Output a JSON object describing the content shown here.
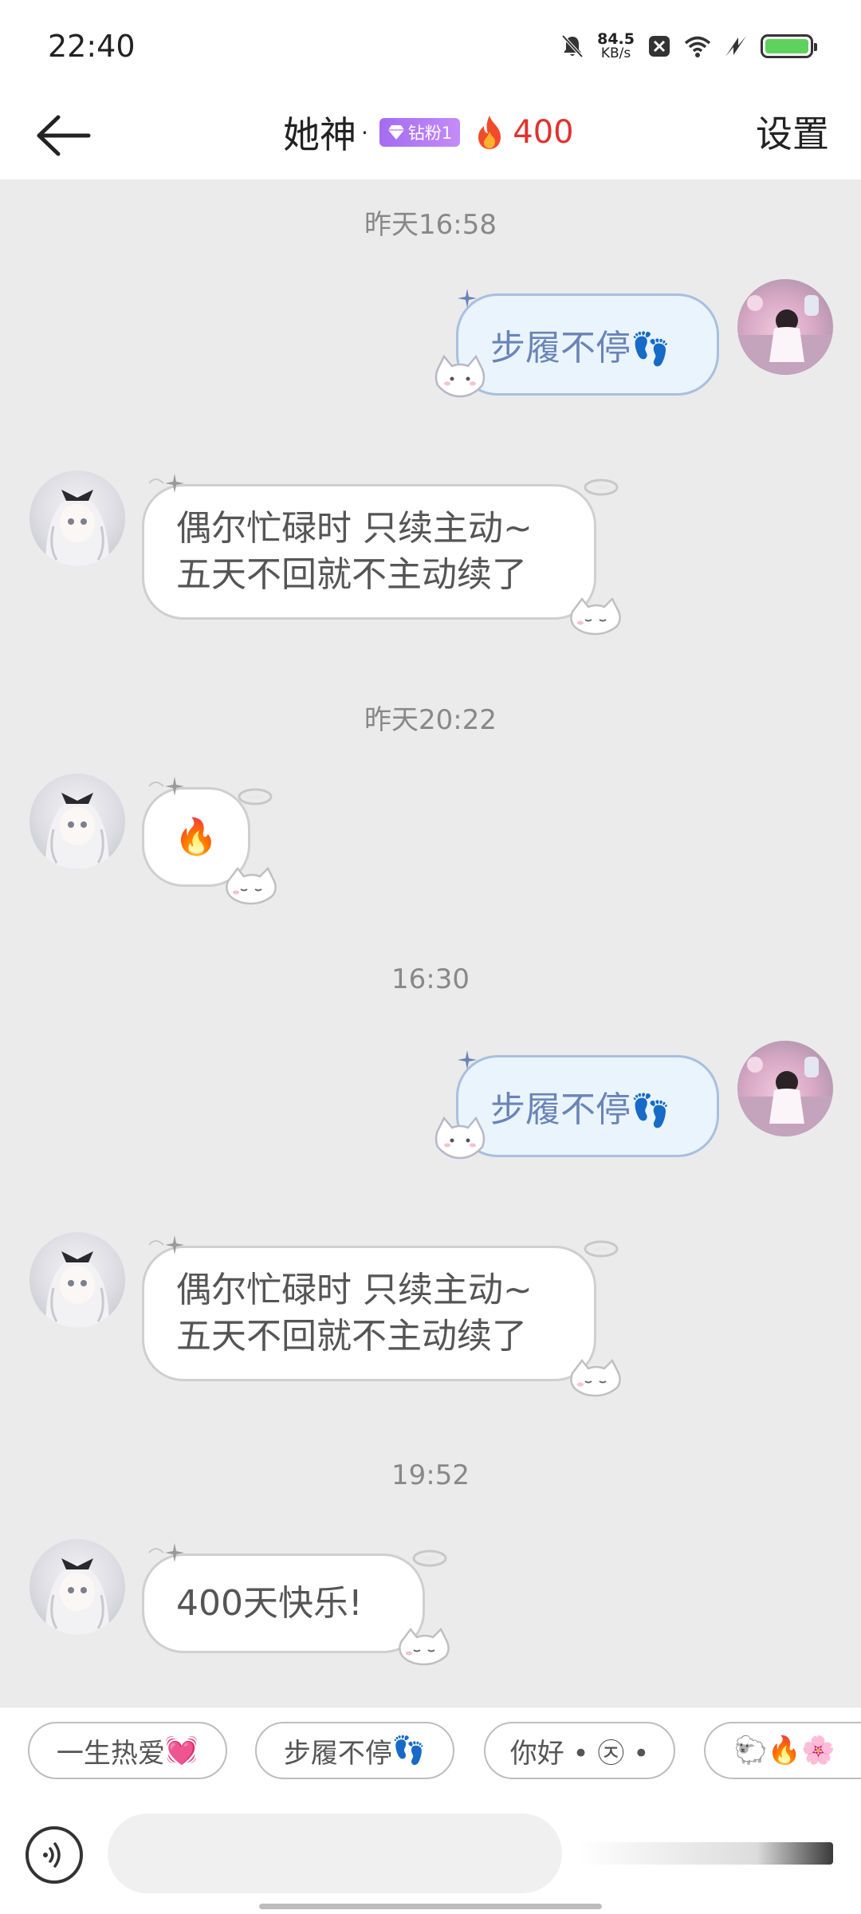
{
  "status_bar": {
    "time": "22:40",
    "net_speed": "84.5",
    "net_unit": "KB/s",
    "icons": [
      "bell-off-icon",
      "close-box-icon",
      "wifi-icon",
      "fast-charge-icon",
      "battery-icon"
    ],
    "battery_level": 1.0,
    "battery_color": "#5ed15e"
  },
  "header": {
    "back_icon": "arrow-left-icon",
    "title": "她神",
    "separator": "·",
    "badge": "钻粉1",
    "badge_icon": "diamond-icon",
    "streak_icon": "flame-icon",
    "streak_count": "400",
    "settings": "设置"
  },
  "chat": {
    "timestamps": [
      "昨天16:58",
      "昨天20:22",
      "16:30",
      "19:52"
    ],
    "messages": [
      {
        "side": "out",
        "text": "步履不停",
        "emoji": "👣"
      },
      {
        "side": "in",
        "lines": [
          "偶尔忙碌时 只续主动~",
          "五天不回就不主动续了"
        ]
      },
      {
        "side": "in",
        "emoji": "🔥"
      },
      {
        "side": "out",
        "text": "步履不停",
        "emoji": "👣"
      },
      {
        "side": "in",
        "lines": [
          "偶尔忙碌时 只续主动~",
          "五天不回就不主动续了"
        ]
      },
      {
        "side": "in",
        "text": "400天快乐!"
      }
    ]
  },
  "quick_replies": [
    {
      "text": "一生热爱",
      "emoji": "💓"
    },
    {
      "text": "步履不停",
      "emoji": "👣"
    },
    {
      "text": "你好 • ㉨ •",
      "emoji": ""
    },
    {
      "text": "",
      "emoji": "🐑🔥🌸"
    }
  ],
  "input": {
    "voice_icon": "voice-icon",
    "placeholder": ""
  },
  "colors": {
    "accent_red": "#e0322e",
    "badge_purple": "#a46cf0",
    "bubble_out_border": "#a8bfe0",
    "chat_bg": "#ebebeb"
  }
}
